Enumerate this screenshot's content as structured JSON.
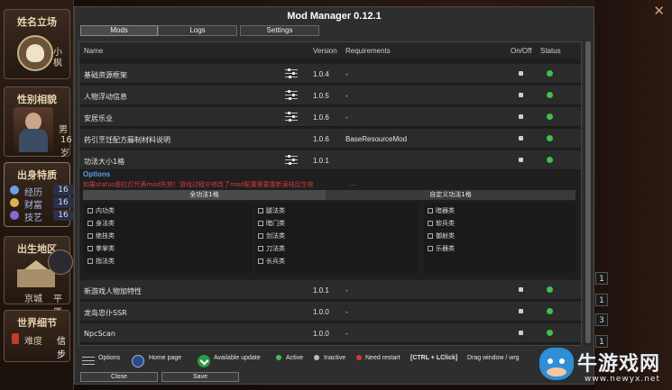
{
  "window": {
    "title": "Mod Manager 0.12.1",
    "tabs": [
      {
        "label": "Mods",
        "active": true
      },
      {
        "label": "Logs",
        "active": false
      },
      {
        "label": "Settings",
        "active": false
      }
    ]
  },
  "columns": {
    "name": "Name",
    "version": "Version",
    "requirements": "Requirements",
    "onoff": "On/Off",
    "status": "Status"
  },
  "mods_top": [
    {
      "name": "基础资源框架",
      "version": "1.0.4",
      "requirements": "-"
    },
    {
      "name": "人物浮动信息",
      "version": "1.0.5",
      "requirements": "-"
    },
    {
      "name": "安居乐业",
      "version": "1.0.6",
      "requirements": "-"
    },
    {
      "name": "药引烹饪配方藤制材料说明",
      "version": "1.0.6",
      "requirements": "BaseResourceMod"
    }
  ],
  "expanded_mod": {
    "name": "功法大小1格",
    "version": "1.0.1",
    "options_title": "Options",
    "warning": "如果status是红灯代表mod失效！游戏过程中修改了mod配置需要重新读档后生效",
    "warning_tail": "...",
    "subtabs": [
      "全功法1格",
      "自定义功法1格"
    ],
    "categories_col1": [
      "内功类",
      "身法类",
      "绝技类",
      "拳掌类",
      "指法类"
    ],
    "categories_col2": [
      "腿法类",
      "暗门类",
      "剑法类",
      "刀法类",
      "长兵类"
    ],
    "categories_col3": [
      "暗器类",
      "软兵类",
      "御射类",
      "乐器类"
    ]
  },
  "mods_bottom": [
    {
      "name": "新游戏人物加特性",
      "version": "1.0.1",
      "requirements": "-"
    },
    {
      "name": "龙岛忠仆SSR",
      "version": "1.0.0",
      "requirements": "-"
    },
    {
      "name": "NpcScan",
      "version": "1.0.0",
      "requirements": "-"
    }
  ],
  "legend": {
    "options": "Options",
    "homepage": "Home page",
    "update": "Available update",
    "active": "Active",
    "inactive": "Inactive",
    "restart": "Need restart",
    "drag_key": "[CTRL + LClick]",
    "drag_text": "Drag window / wrg"
  },
  "buttons": {
    "close": "Close",
    "save": "Save"
  },
  "side": {
    "sect1_title": "姓名立场",
    "char_name": "小枫",
    "sect2_title": "性别相貌",
    "gender": "男",
    "age": "16岁",
    "sect3_title": "出身特质",
    "traits": [
      {
        "label": "经历",
        "value": "16"
      },
      {
        "label": "财富",
        "value": "16"
      },
      {
        "label": "技艺",
        "value": "16"
      }
    ],
    "sect4_title": "出生地区",
    "city": "京城",
    "plain": "平原",
    "sect5_title": "世界细节",
    "difficulty_label": "难度",
    "difficulty_value": "信步"
  },
  "right_nums": [
    "1",
    "1",
    "3",
    "1"
  ],
  "watermark": {
    "text": "牛游戏网",
    "url": "www.newyx.net"
  },
  "colors": {
    "active": "#3fbf4f",
    "inactive": "#bdbdbd",
    "restart": "#d83a3a",
    "options_title": "#5aa0e8"
  }
}
